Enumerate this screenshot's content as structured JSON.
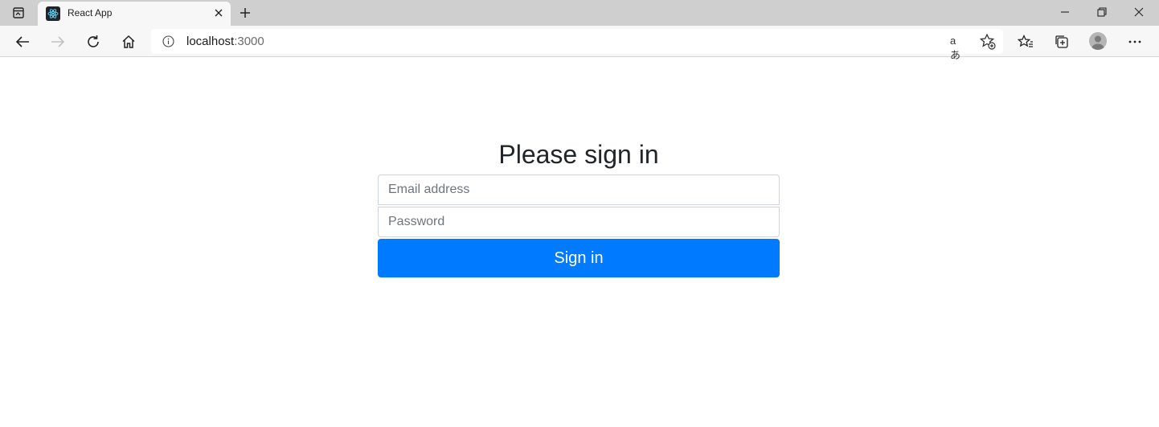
{
  "browser": {
    "tab": {
      "title": "React App"
    },
    "address": {
      "host": "localhost",
      "port": ":3000"
    },
    "read_aloud_label": "aあ",
    "colors": {
      "tabbar": "#cfcfcf",
      "toolbar": "#f7f7f7"
    }
  },
  "page": {
    "heading": "Please sign in",
    "email_placeholder": "Email address",
    "password_placeholder": "Password",
    "submit_label": "Sign in",
    "accent_color": "#007bff"
  }
}
